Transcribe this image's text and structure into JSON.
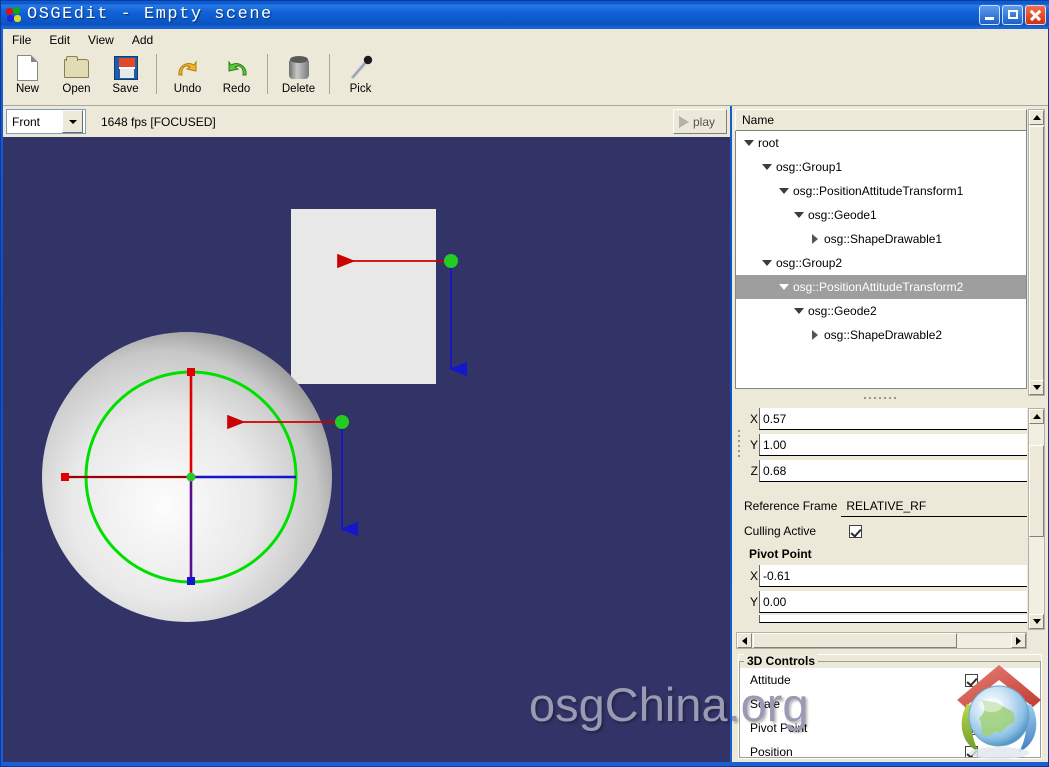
{
  "window": {
    "title": "OSGEdit - Empty scene",
    "buttons": {
      "minimize": "minimize",
      "maximize": "maximize",
      "close": "close"
    }
  },
  "menubar": {
    "items": [
      {
        "label": "File"
      },
      {
        "label": "Edit"
      },
      {
        "label": "View"
      },
      {
        "label": "Add"
      }
    ]
  },
  "toolbar": {
    "buttons": [
      {
        "label": "New",
        "icon": "new-document-icon"
      },
      {
        "label": "Open",
        "icon": "open-folder-icon"
      },
      {
        "label": "Save",
        "icon": "floppy-disk-icon"
      },
      {
        "label": "Undo",
        "icon": "undo-arrow-icon"
      },
      {
        "label": "Redo",
        "icon": "redo-arrow-icon"
      },
      {
        "label": "Delete",
        "icon": "trash-can-icon"
      },
      {
        "label": "Pick",
        "icon": "eyedropper-icon"
      }
    ]
  },
  "viewport_toolbar": {
    "view_selector": {
      "value": "Front",
      "icon": "chevron-down-icon"
    },
    "status": "1648 fps  [FOCUSED]",
    "fps": "1648 fps",
    "focus_state": "[FOCUSED]",
    "play_button": {
      "label": "play",
      "icon": "play-triangle-icon"
    }
  },
  "viewport": {
    "background_color": "#323366",
    "watermark": "osgChina.org",
    "objects": {
      "sphere": "shaded-sphere",
      "box": "white-box",
      "gizmo_ring_color": "#00e000",
      "axis_x_color": "#cc0000",
      "axis_y_color": "#0000cc",
      "axis_z_color": "#5c0e8a",
      "handle_color": "#22cc22"
    }
  },
  "tree": {
    "header": "Name",
    "nodes": [
      {
        "label": "root",
        "depth": 0,
        "expander": "down",
        "selected": false
      },
      {
        "label": "osg::Group1",
        "depth": 1,
        "expander": "down",
        "selected": false
      },
      {
        "label": "osg::PositionAttitudeTransform1",
        "depth": 2,
        "expander": "down",
        "selected": false
      },
      {
        "label": "osg::Geode1",
        "depth": 3,
        "expander": "down",
        "selected": false
      },
      {
        "label": "osg::ShapeDrawable1",
        "depth": 4,
        "expander": "right",
        "selected": false
      },
      {
        "label": "osg::Group2",
        "depth": 1,
        "expander": "down",
        "selected": false
      },
      {
        "label": "osg::PositionAttitudeTransform2",
        "depth": 2,
        "expander": "down",
        "selected": true
      },
      {
        "label": "osg::Geode2",
        "depth": 3,
        "expander": "down",
        "selected": false
      },
      {
        "label": "osg::ShapeDrawable2",
        "depth": 4,
        "expander": "right",
        "selected": false
      }
    ]
  },
  "properties": {
    "vector_fields": [
      {
        "axis": "X",
        "value": "0.57"
      },
      {
        "axis": "Y",
        "value": "1.00"
      },
      {
        "axis": "Z",
        "value": "0.68"
      }
    ],
    "reference_frame": {
      "label": "Reference Frame",
      "value": "RELATIVE_RF"
    },
    "culling_active": {
      "label": "Culling Active",
      "checked": true
    },
    "pivot_point": {
      "title": "Pivot Point",
      "fields": [
        {
          "axis": "X",
          "value": "-0.61"
        },
        {
          "axis": "Y",
          "value": "0.00"
        }
      ]
    }
  },
  "controls_3d": {
    "title": "3D Controls",
    "items": [
      {
        "label": "Attitude",
        "checked": true
      },
      {
        "label": "Scale",
        "checked": true
      },
      {
        "label": "Pivot Point",
        "checked": true
      },
      {
        "label": "Position",
        "checked": true
      }
    ]
  },
  "logo": {
    "name": "osgchina-globe-logo"
  }
}
